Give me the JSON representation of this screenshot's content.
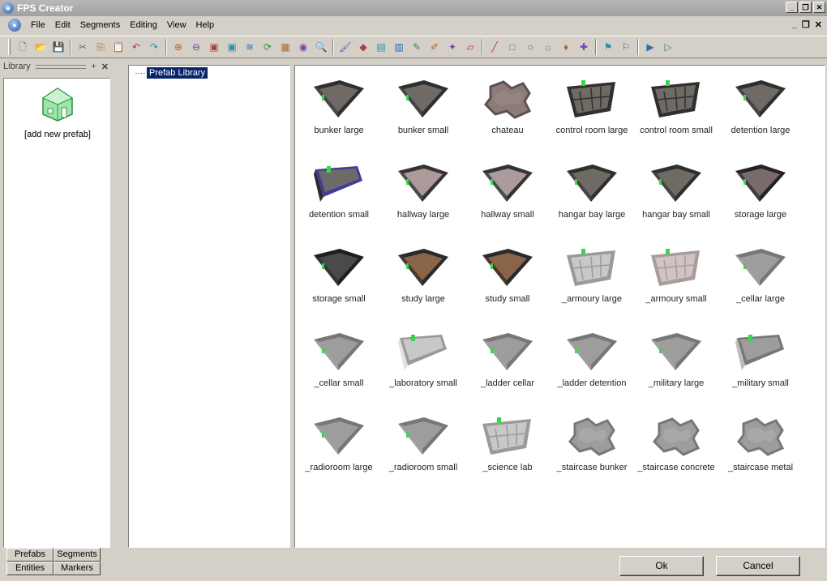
{
  "window": {
    "title": "FPS Creator",
    "controls": [
      "_",
      "❐",
      "✕"
    ]
  },
  "menu": {
    "items": [
      "File",
      "Edit",
      "Segments",
      "Editing",
      "View",
      "Help"
    ],
    "mdi_controls": [
      "_",
      "❐",
      "✕"
    ]
  },
  "toolbar": {
    "groups": [
      [
        "new-icon",
        "open-icon",
        "save-icon"
      ],
      [
        "cut-icon",
        "copy-icon",
        "paste-icon",
        "undo-icon",
        "redo-icon"
      ],
      [
        "zoom-in-icon",
        "zoom-out-icon",
        "layer-up-icon",
        "layer-down-icon",
        "layers-icon",
        "rotate-icon",
        "map-icon",
        "view-icon",
        "magnify-icon"
      ],
      [
        "paint-icon",
        "fill-icon",
        "segment-icon",
        "segment2-icon",
        "pencil-icon",
        "brush-icon",
        "picker-icon",
        "eraser-icon"
      ],
      [
        "line-icon",
        "rect-icon",
        "circle-icon",
        "light-icon",
        "entity-icon",
        "marker-icon"
      ],
      [
        "flag-icon",
        "flag2-icon"
      ],
      [
        "test-game-icon",
        "build-game-icon"
      ]
    ]
  },
  "library": {
    "title": "Library",
    "pin": "+",
    "close": "✕",
    "new_prefab_label": "[add new prefab]",
    "tabs": [
      [
        "Prefabs",
        "Segments"
      ],
      [
        "Entities",
        "Markers"
      ]
    ]
  },
  "tree": {
    "root_label": "Prefab Library"
  },
  "prefabs": [
    {
      "label": "bunker large",
      "style": "dark",
      "shape": "box"
    },
    {
      "label": "bunker small",
      "style": "dark",
      "shape": "box"
    },
    {
      "label": "chateau",
      "style": "brown",
      "shape": "cross"
    },
    {
      "label": "control room large",
      "style": "dark",
      "shape": "wide"
    },
    {
      "label": "control room small",
      "style": "dark",
      "shape": "wide"
    },
    {
      "label": "detention large",
      "style": "dark",
      "shape": "box"
    },
    {
      "label": "detention small",
      "style": "blue",
      "shape": "tilt"
    },
    {
      "label": "hallway large",
      "style": "pink",
      "shape": "box"
    },
    {
      "label": "hallway small",
      "style": "pink",
      "shape": "box"
    },
    {
      "label": "hangar bay large",
      "style": "dark",
      "shape": "box"
    },
    {
      "label": "hangar bay small",
      "style": "dark",
      "shape": "box"
    },
    {
      "label": "storage large",
      "style": "darkpink",
      "shape": "box"
    },
    {
      "label": "storage small",
      "style": "black",
      "shape": "box"
    },
    {
      "label": "study large",
      "style": "wood",
      "shape": "box"
    },
    {
      "label": "study small",
      "style": "wood",
      "shape": "box"
    },
    {
      "label": "_armoury large",
      "style": "light",
      "shape": "wide"
    },
    {
      "label": "_armoury small",
      "style": "lightpink",
      "shape": "wide"
    },
    {
      "label": "_cellar large",
      "style": "grey",
      "shape": "box"
    },
    {
      "label": "_cellar small",
      "style": "grey",
      "shape": "box"
    },
    {
      "label": "_laboratory small",
      "style": "light",
      "shape": "tilt"
    },
    {
      "label": "_ladder cellar",
      "style": "grey",
      "shape": "box"
    },
    {
      "label": "_ladder detention",
      "style": "grey",
      "shape": "box"
    },
    {
      "label": "_military large",
      "style": "grey",
      "shape": "box"
    },
    {
      "label": "_military small",
      "style": "grey",
      "shape": "tilt"
    },
    {
      "label": "_radioroom large",
      "style": "grey",
      "shape": "box"
    },
    {
      "label": "_radioroom small",
      "style": "grey",
      "shape": "box"
    },
    {
      "label": "_science lab",
      "style": "light",
      "shape": "wide"
    },
    {
      "label": "_staircase bunker",
      "style": "grey",
      "shape": "cross"
    },
    {
      "label": "_staircase concrete",
      "style": "grey",
      "shape": "cross"
    },
    {
      "label": "_staircase metal",
      "style": "grey",
      "shape": "cross"
    }
  ],
  "colors": {
    "dark": {
      "floor": "#6f6a63",
      "wall": "#2f2f2f",
      "rim": "#555555"
    },
    "brown": {
      "floor": "#8d7b78",
      "wall": "#5c5150",
      "rim": "#a79896"
    },
    "blue": {
      "floor": "#6d6b6a",
      "wall": "#403d9a",
      "rim": "#2c2c2c"
    },
    "pink": {
      "floor": "#ad9a9a",
      "wall": "#343434",
      "rim": "#5b5b5b"
    },
    "darkpink": {
      "floor": "#7a6a6a",
      "wall": "#232323",
      "rim": "#505050"
    },
    "black": {
      "floor": "#4a4a4a",
      "wall": "#1e1e1e",
      "rim": "#444444"
    },
    "wood": {
      "floor": "#8a6448",
      "wall": "#2a2a2a",
      "rim": "#5a4436"
    },
    "light": {
      "floor": "#c8c8c8",
      "wall": "#9a9a9a",
      "rim": "#e2e2e2"
    },
    "lightpink": {
      "floor": "#cfc3c3",
      "wall": "#a79c9c",
      "rim": "#e7dede"
    },
    "grey": {
      "floor": "#9d9d9d",
      "wall": "#777777",
      "rim": "#bdbdbd"
    },
    "accent_green": "#35d84a",
    "selection": "#0a246a"
  },
  "buttons": {
    "ok": "Ok",
    "cancel": "Cancel"
  }
}
